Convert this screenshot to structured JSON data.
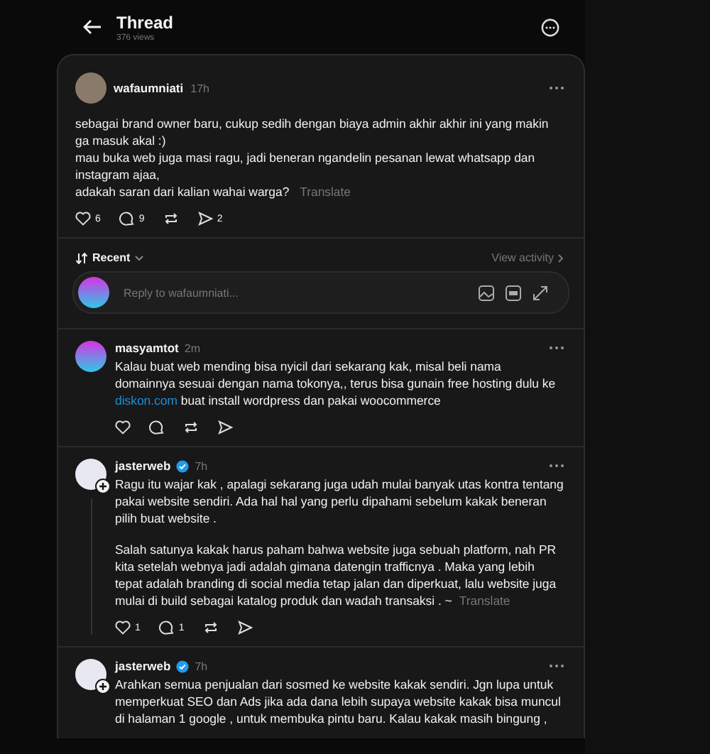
{
  "header": {
    "title": "Thread",
    "views": "376 views"
  },
  "post": {
    "author": "wafaumniati",
    "time": "17h",
    "paragraphs": [
      "sebagai brand owner baru, cukup sedih dengan biaya admin akhir akhir ini yang makin ga masuk akal :)",
      "mau buka web juga masi ragu, jadi beneran ngandelin pesanan lewat whatsapp dan instagram ajaa,",
      "adakah saran dari kalian wahai warga?"
    ],
    "translate": "Translate",
    "likes": "6",
    "replies": "9",
    "shares": "2"
  },
  "sort": {
    "label": "Recent",
    "view_activity": "View activity"
  },
  "reply_box": {
    "placeholder": "Reply to wafaumniati..."
  },
  "replies": [
    {
      "author": "masyamtot",
      "verified": false,
      "follow": false,
      "thread_line": false,
      "time": "2m",
      "paragraphs": [
        {
          "before": "Kalau buat web mending bisa nyicil dari sekarang kak, misal beli nama domainnya sesuai dengan nama tokonya,, terus bisa gunain free hosting dulu ke ",
          "link": "diskon.com",
          "after": " buat install wordpress dan pakai woocommerce"
        }
      ],
      "show_stats": true
    },
    {
      "author": "jasterweb",
      "verified": true,
      "follow": true,
      "thread_line": true,
      "time": "7h",
      "paragraphs": [
        {
          "before": "Ragu itu wajar kak , apalagi sekarang juga udah mulai banyak utas kontra tentang pakai website sendiri. Ada hal hal yang perlu dipahami sebelum kakak beneran pilih buat website ."
        },
        {
          "before": "Salah satunya kakak harus paham bahwa website juga sebuah platform, nah PR kita setelah webnya jadi adalah gimana datengin trafficnya . Maka yang lebih tepat adalah branding di social media tetap jalan dan diperkuat, lalu website juga mulai di build sebagai katalog produk dan wadah transaksi . ~",
          "translate": "Translate"
        }
      ],
      "stats": {
        "likes": "1",
        "replies": "1"
      },
      "show_stats": true
    },
    {
      "author": "jasterweb",
      "verified": true,
      "follow": true,
      "thread_line": false,
      "time": "7h",
      "paragraphs": [
        {
          "before": "Arahkan semua penjualan dari sosmed ke website kakak sendiri. Jgn lupa untuk memperkuat SEO dan Ads jika ada dana lebih supaya website kakak bisa muncul di halaman 1 google , untuk membuka pintu baru. Kalau kakak masih bingung ,"
        }
      ],
      "show_stats": false
    }
  ]
}
